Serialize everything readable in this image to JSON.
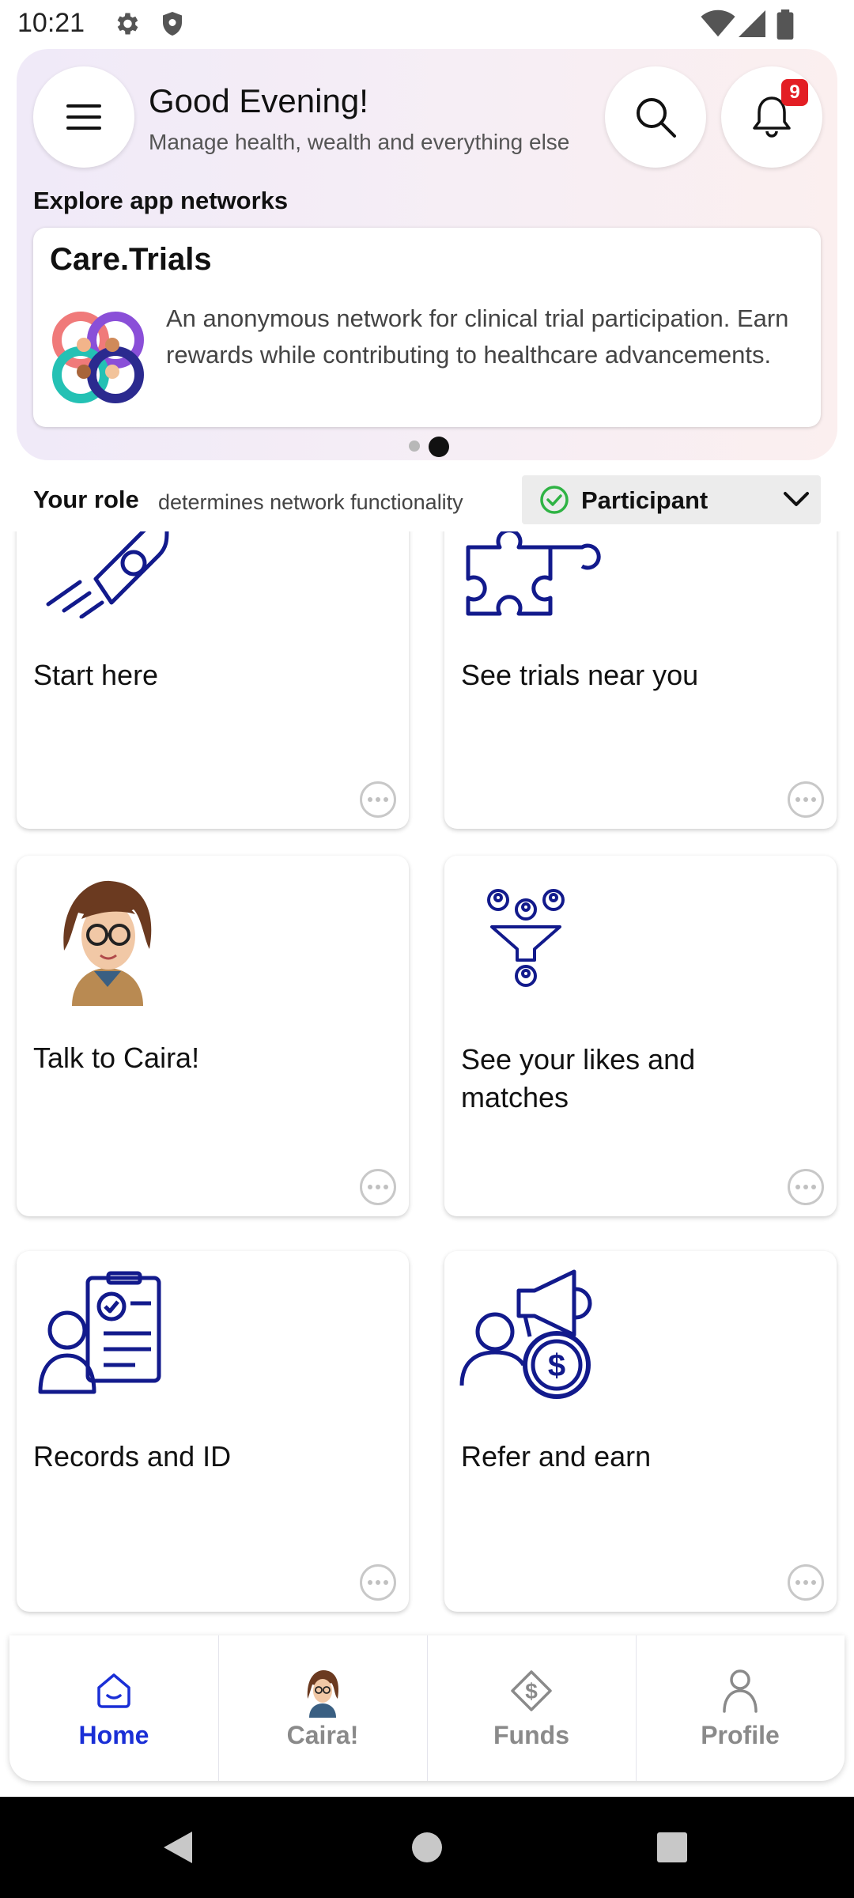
{
  "status_bar": {
    "time": "10:21",
    "left_icons": [
      "gear-icon",
      "shield-icon"
    ],
    "right_icons": [
      "wifi-icon",
      "cellular-icon",
      "battery-icon"
    ]
  },
  "header": {
    "greeting": "Good Evening!",
    "subtitle": "Manage health, wealth and everything else",
    "notification_count": "9"
  },
  "explore": {
    "label": "Explore app networks",
    "card": {
      "title": "Care.Trials",
      "description": "An anonymous network for clinical trial participation. Earn rewards while contributing to healthcare advancements."
    },
    "pager": {
      "count": 2,
      "active": 2
    }
  },
  "role": {
    "label": "Your role",
    "description": "determines network functionality",
    "selected": "Participant"
  },
  "tiles": [
    {
      "label": "Start here",
      "icon": "rocket-icon"
    },
    {
      "label": "See trials near you",
      "icon": "puzzle-icon"
    },
    {
      "label": "Talk to Caira!",
      "icon": "caira-avatar"
    },
    {
      "label": "See your likes and matches",
      "icon": "funnel-people-icon"
    },
    {
      "label": "Records and ID",
      "icon": "records-id-icon"
    },
    {
      "label": "Refer and earn",
      "icon": "megaphone-dollar-icon"
    }
  ],
  "bottom_nav": [
    {
      "label": "Home",
      "icon": "home-icon",
      "active": true
    },
    {
      "label": "Caira!",
      "icon": "caira-avatar",
      "active": false
    },
    {
      "label": "Funds",
      "icon": "funds-icon",
      "active": false
    },
    {
      "label": "Profile",
      "icon": "profile-icon",
      "active": false
    }
  ],
  "colors": {
    "accent": "#1a2fd6",
    "icon_navy": "#121a8c",
    "badge": "#e31e24",
    "check_green": "#2fb344"
  }
}
